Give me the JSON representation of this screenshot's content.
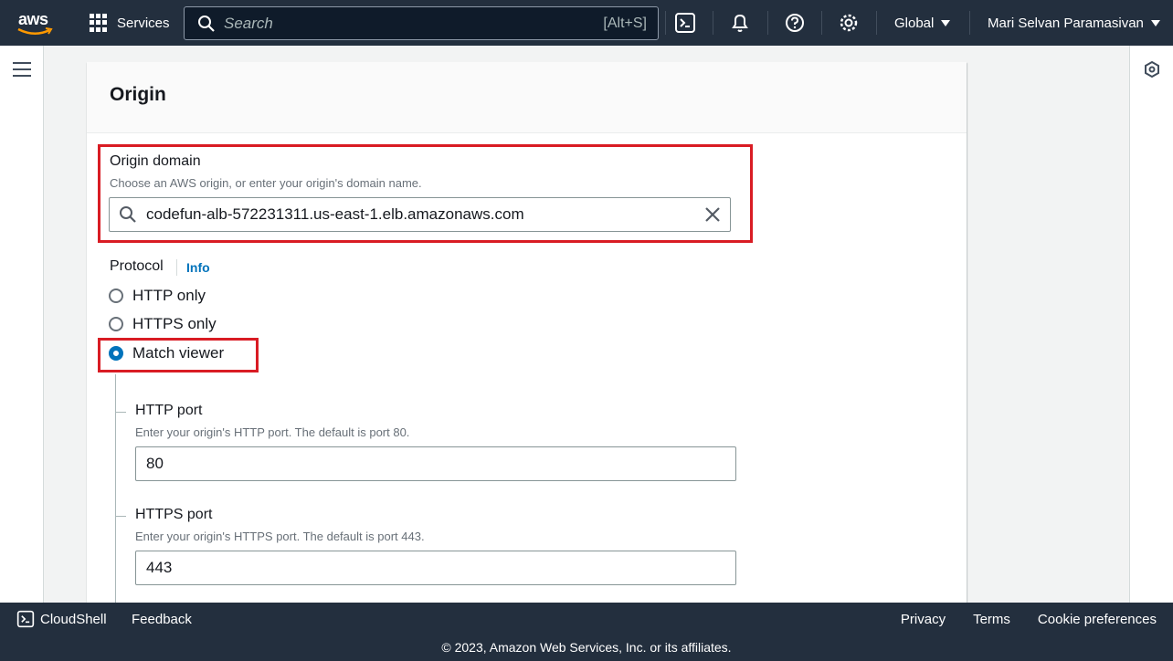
{
  "topnav": {
    "logo_text": "aws",
    "services_label": "Services",
    "search_placeholder": "Search",
    "search_shortcut": "[Alt+S]",
    "region_label": "Global",
    "user_label": "Mari Selvan Paramasivan"
  },
  "card": {
    "title": "Origin",
    "origin_domain": {
      "label": "Origin domain",
      "description": "Choose an AWS origin, or enter your origin's domain name.",
      "value": "codefun-alb-572231311.us-east-1.elb.amazonaws.com"
    },
    "protocol": {
      "label": "Protocol",
      "info_link": "Info",
      "options": [
        {
          "label": "HTTP only",
          "checked": false
        },
        {
          "label": "HTTPS only",
          "checked": false
        },
        {
          "label": "Match viewer",
          "checked": true
        }
      ]
    },
    "http_port": {
      "label": "HTTP port",
      "description": "Enter your origin's HTTP port. The default is port 80.",
      "value": "80"
    },
    "https_port": {
      "label": "HTTPS port",
      "description": "Enter your origin's HTTPS port. The default is port 443.",
      "value": "443"
    }
  },
  "footer": {
    "cloudshell_label": "CloudShell",
    "feedback_label": "Feedback",
    "privacy_label": "Privacy",
    "terms_label": "Terms",
    "cookie_label": "Cookie preferences",
    "copyright": "© 2023, Amazon Web Services, Inc. or its affiliates."
  },
  "colors": {
    "nav_bg": "#232f3e",
    "highlight": "#d91c24",
    "accent": "#0073bb"
  },
  "icons": [
    "aws-logo",
    "services-grid-icon",
    "search-icon",
    "cloudshell-icon",
    "bell-icon",
    "help-icon",
    "gear-icon",
    "menu-icon",
    "clear-icon",
    "hexagon-icon"
  ]
}
